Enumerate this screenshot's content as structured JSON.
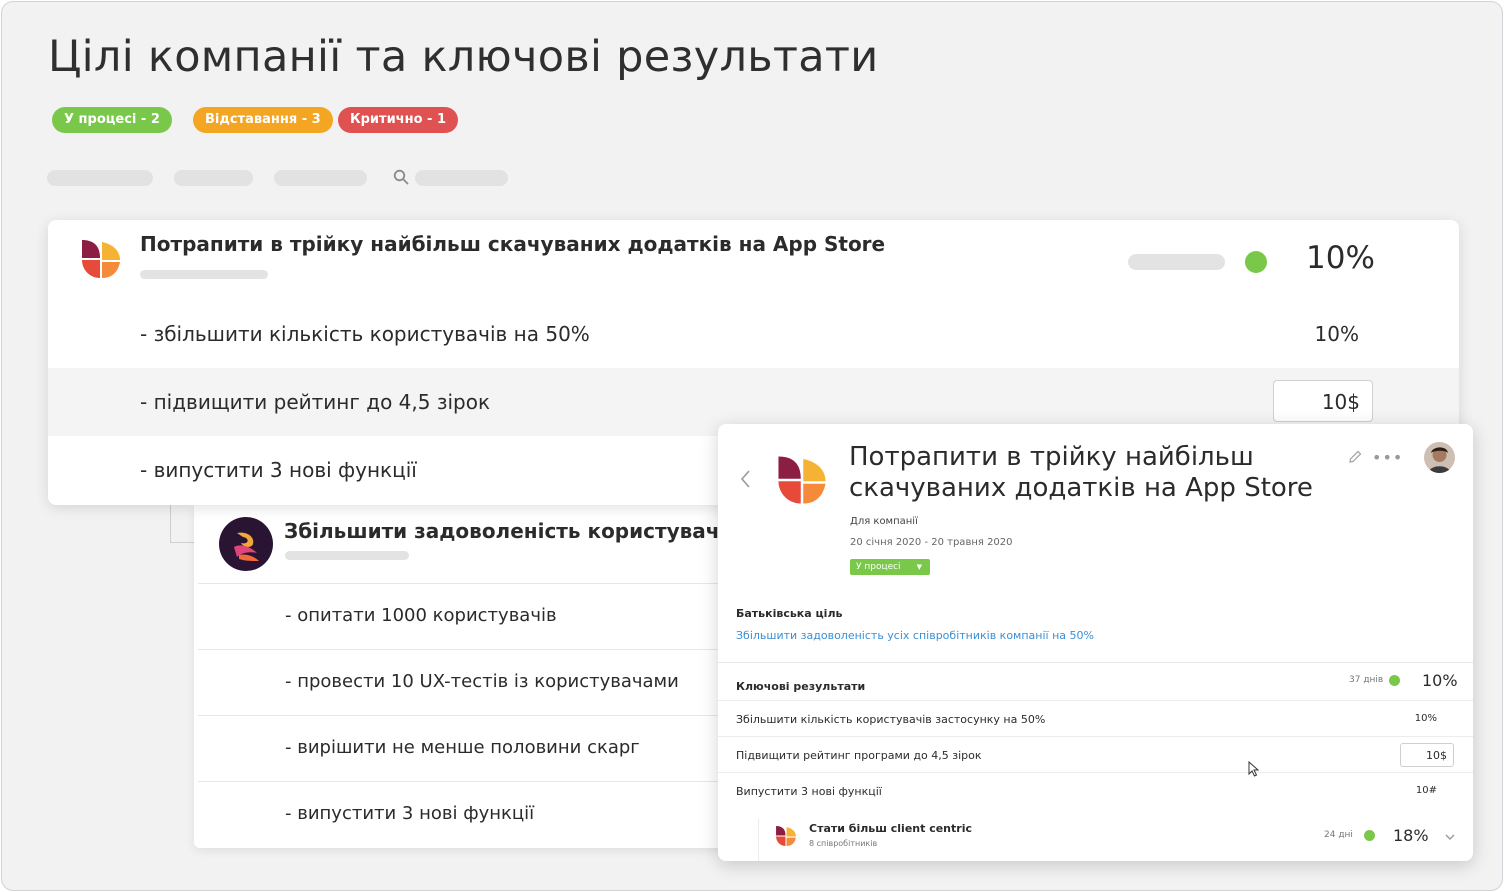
{
  "page": {
    "title": "Цілі компанії та ключові результати"
  },
  "status_badges": [
    {
      "label": "У процесі - 2",
      "color": "#7ac84a"
    },
    {
      "label": "Відставання - 3",
      "color": "#f4a521"
    },
    {
      "label": "Критично - 1",
      "color": "#e05252"
    }
  ],
  "toolbar": {
    "search_icon": "search-icon"
  },
  "main_objective": {
    "title": "Потрапити в трійку найбільш скачуваних додатків на App Store",
    "progress": "10%",
    "status_color": "#7ac84a",
    "key_results": [
      {
        "label": "- збільшити кількість користувачів на 50%",
        "value": "10%"
      },
      {
        "label": "- підвищити рейтинг до 4,5 зірок",
        "value": "10$"
      },
      {
        "label": "- випустити 3 нові функції",
        "value": ""
      }
    ]
  },
  "secondary_objective": {
    "title": "Збільшити задоволеність користувачів на",
    "key_results": [
      {
        "label": "- опитати 1000 користувачів"
      },
      {
        "label": "- провести 10 UX-тестів із користувачами"
      },
      {
        "label": "- вирішити не менше половини скарг"
      },
      {
        "label": "- випустити 3 нові функції"
      }
    ]
  },
  "detail_panel": {
    "title": "Потрапити в трійку найбільш скачуваних додатків на App Store",
    "for_label": "Для компанії",
    "dates": "20 січня 2020 - 20 травня 2020",
    "status": "У процесі",
    "parent_heading": "Батьківська ціль",
    "parent_link": "Збільшити задоволеність усіх співробітників компанії на 50%",
    "kr_heading": "Ключові результати",
    "kr_days": "37 днів",
    "kr_progress": "10%",
    "rows": [
      {
        "label": "Збільшити кількість користувачів застосунку на 50%",
        "value": "10%"
      },
      {
        "label": "Підвищити рейтинг програми до 4,5 зірок",
        "value": "10$"
      },
      {
        "label": "Випустити 3 нові функції",
        "value": "10#"
      }
    ],
    "child": {
      "title": "Стати більш client centric",
      "subtitle": "8 співробітників",
      "days": "24 дні",
      "progress": "18%"
    }
  }
}
